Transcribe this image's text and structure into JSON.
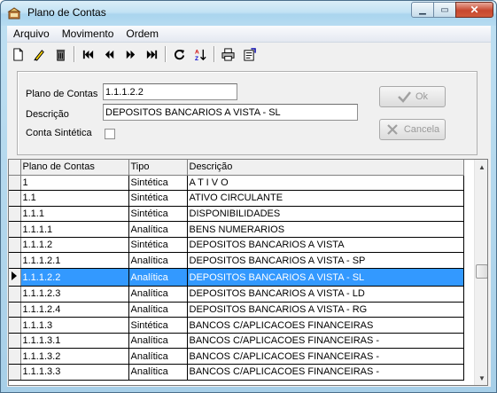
{
  "window": {
    "title": "Plano de Contas"
  },
  "menu": [
    "Arquivo",
    "Movimento",
    "Ordem"
  ],
  "toolbar": {
    "icons": [
      "new-icon",
      "edit-icon",
      "delete-icon",
      "first-icon",
      "prior-icon",
      "next-icon",
      "last-icon",
      "refresh-icon",
      "sort-icon",
      "print-icon",
      "properties-icon"
    ]
  },
  "form": {
    "plano_label": "Plano de Contas",
    "plano_value": "1.1.1.2.2",
    "descricao_label": "Descrição",
    "descricao_value": "DEPOSITOS BANCARIOS A VISTA - SL",
    "sintetica_label": "Conta Sintética",
    "ok_label": "Ok",
    "cancela_label": "Cancela"
  },
  "grid": {
    "columns": [
      "Plano de Contas",
      "Tipo",
      "Descrição"
    ],
    "rows": [
      [
        "1",
        "Sintética",
        "A T I V O"
      ],
      [
        "1.1",
        "Sintética",
        "ATIVO CIRCULANTE"
      ],
      [
        "1.1.1",
        "Sintética",
        "DISPONIBILIDADES"
      ],
      [
        "1.1.1.1",
        "Analítica",
        "BENS NUMERARIOS"
      ],
      [
        "1.1.1.2",
        "Sintética",
        "DEPOSITOS BANCARIOS A VISTA"
      ],
      [
        "1.1.1.2.1",
        "Analítica",
        "DEPOSITOS BANCARIOS A VISTA - SP"
      ],
      [
        "1.1.1.2.2",
        "Analítica",
        "DEPOSITOS BANCARIOS A VISTA - SL"
      ],
      [
        "1.1.1.2.3",
        "Analítica",
        "DEPOSITOS BANCARIOS A VISTA - LD"
      ],
      [
        "1.1.1.2.4",
        "Analítica",
        "DEPOSITOS BANCARIOS A VISTA - RG"
      ],
      [
        "1.1.1.3",
        "Sintética",
        "BANCOS C/APLICACOES FINANCEIRAS"
      ],
      [
        "1.1.1.3.1",
        "Analítica",
        "BANCOS C/APLICACOES FINANCEIRAS -"
      ],
      [
        "1.1.1.3.2",
        "Analítica",
        "BANCOS C/APLICACOES FINANCEIRAS -"
      ],
      [
        "1.1.1.3.3",
        "Analítica",
        "BANCOS C/APLICACOES FINANCEIRAS -"
      ]
    ],
    "selected_index": 6,
    "selection_color": "#3399ff"
  }
}
